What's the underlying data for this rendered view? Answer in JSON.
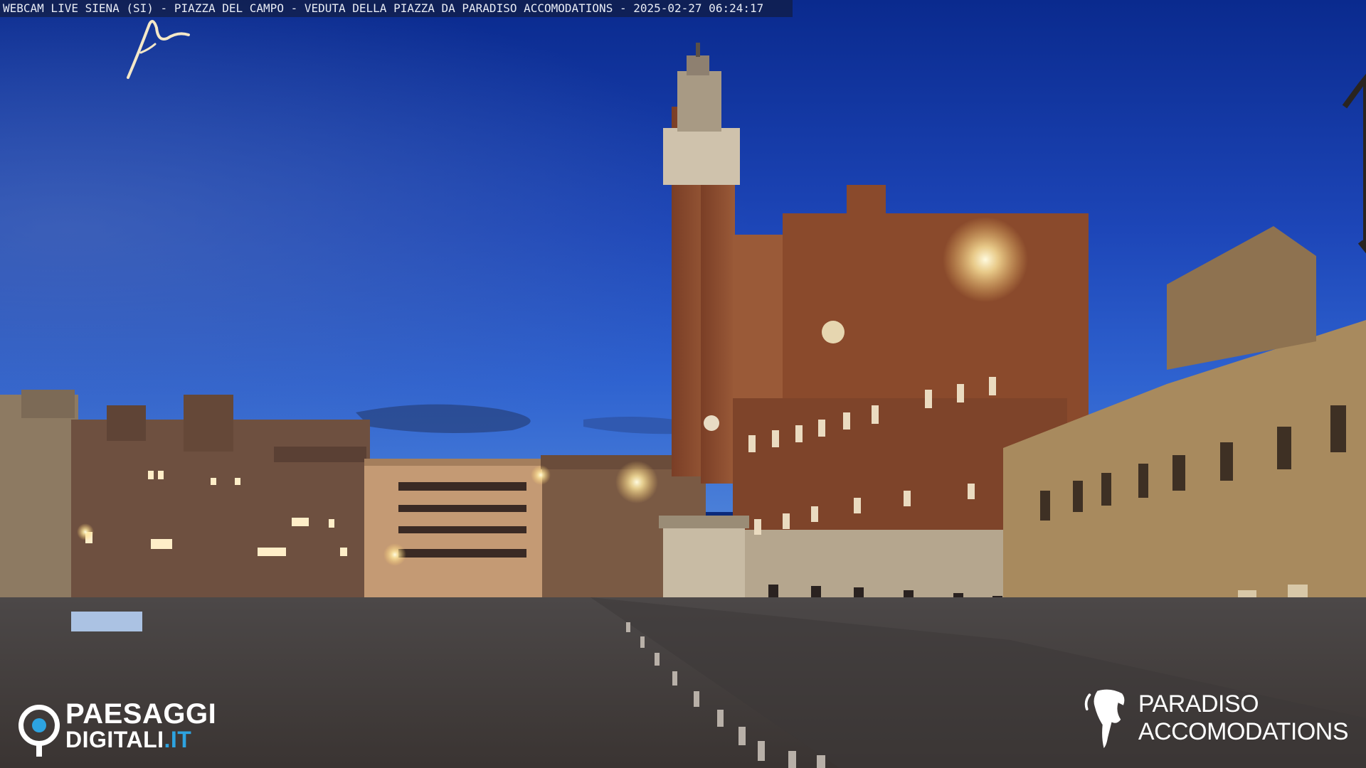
{
  "caption": "WEBCAM LIVE SIENA (SI) - PIAZZA DEL CAMPO - VEDUTA DELLA PIAZZA DA PARADISO ACCOMODATIONS - 2025-02-27 06:24:17",
  "logo_left": {
    "line1": "PAESAGGI",
    "line2_main": "DIGITALI",
    "line2_tld": ".IT"
  },
  "logo_right": {
    "line1": "PARADISO",
    "line2": "ACCOMODATIONS"
  },
  "colors": {
    "sky_top": "#0d2e95",
    "sky_bottom": "#3a6fd0",
    "brick": "#8a4a2c",
    "stone": "#a88a5e",
    "pavement": "#4a4440",
    "lamp": "#fff3c0",
    "accent_blue": "#2da3e0"
  },
  "icons": [
    "paesaggi-digitali-logo-icon",
    "paradiso-horse-logo-icon",
    "signature-mark"
  ]
}
